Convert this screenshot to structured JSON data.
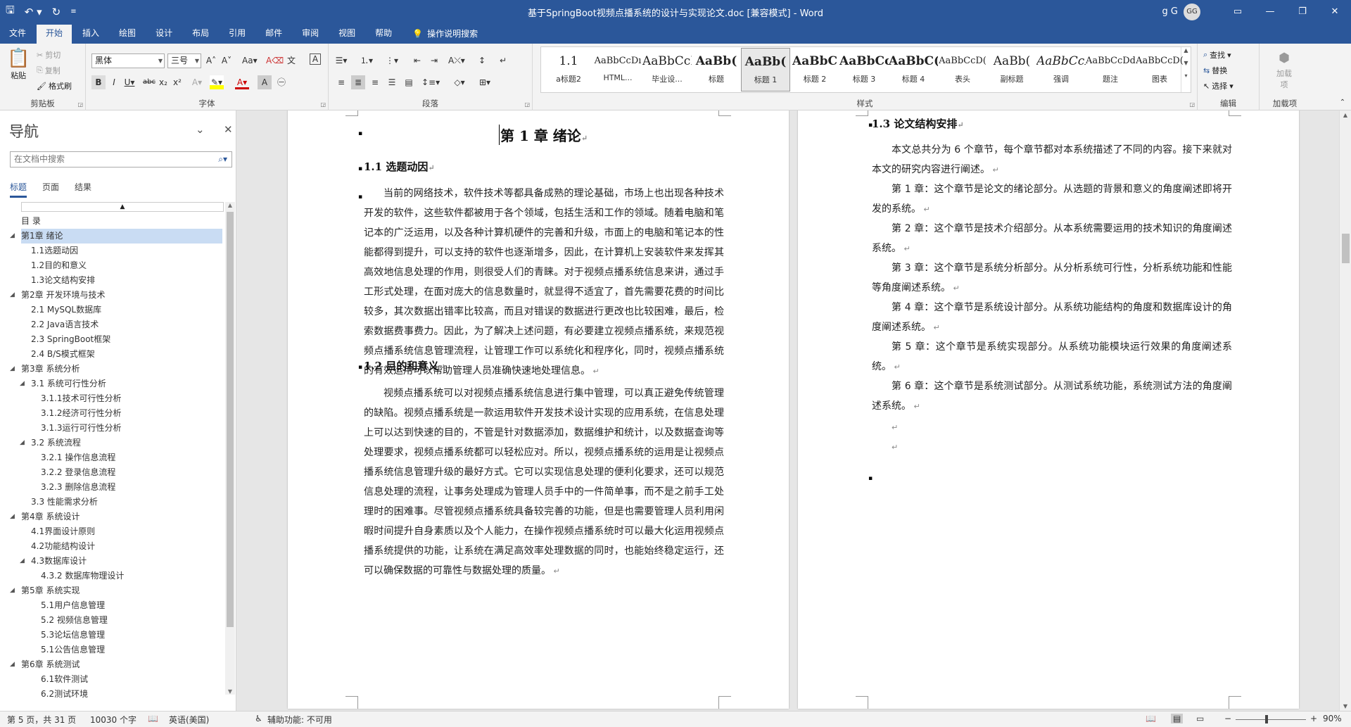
{
  "titlebar": {
    "title": "基于SpringBoot视频点播系统的设计与实现论文.doc [兼容模式] - Word",
    "user": "g G",
    "avatar": "GG",
    "buttons": [
      "ribbon-display-icon",
      "minimize-icon",
      "restore-icon",
      "close-icon"
    ]
  },
  "menu": {
    "tabs": [
      "文件",
      "开始",
      "插入",
      "绘图",
      "设计",
      "布局",
      "引用",
      "邮件",
      "审阅",
      "视图",
      "帮助"
    ],
    "active": "开始",
    "tellme": "操作说明搜索"
  },
  "ribbon": {
    "clipboard": {
      "label": "剪贴板",
      "paste": "粘贴",
      "cut": "剪切",
      "copy": "复制",
      "painter": "格式刷"
    },
    "font": {
      "label": "字体",
      "family": "黑体",
      "size": "三号"
    },
    "paragraph": {
      "label": "段落"
    },
    "styles": {
      "label": "样式",
      "items": [
        {
          "preview": "1.1",
          "name": "a标题2"
        },
        {
          "preview": "AaBbCcDı",
          "name": "HTML..."
        },
        {
          "preview": "AaBbCcI",
          "name": "毕业设..."
        },
        {
          "preview": "AaBb(",
          "name": "标题"
        },
        {
          "preview": "AaBb(",
          "name": "标题 1"
        },
        {
          "preview": "AaBbC",
          "name": "标题 2"
        },
        {
          "preview": "AaBbCc",
          "name": "标题 3"
        },
        {
          "preview": "AaBbC(",
          "name": "标题 4"
        },
        {
          "preview": "AaBbCcD(",
          "name": "表头"
        },
        {
          "preview": "AaBb(",
          "name": "副标题"
        },
        {
          "preview": "AaBbCcL",
          "name": "强调"
        },
        {
          "preview": "AaBbCcDd",
          "name": "题注"
        },
        {
          "preview": "AaBbCcD(",
          "name": "图表"
        }
      ],
      "active_index": 4
    },
    "editing": {
      "label": "编辑",
      "find": "查找",
      "replace": "替换",
      "select": "选择"
    },
    "addins": {
      "label": "加载项",
      "btn": "加载项"
    }
  },
  "nav": {
    "title": "导航",
    "search_placeholder": "在文档中搜索",
    "tabs": [
      "标题",
      "页面",
      "结果"
    ],
    "items": [
      {
        "text": "目  录",
        "level": 0,
        "arrow": ""
      },
      {
        "text": "第1章 绪论",
        "level": 0,
        "arrow": "◢",
        "selected": true
      },
      {
        "text": "1.1选题动因",
        "level": 1,
        "arrow": ""
      },
      {
        "text": "1.2目的和意义",
        "level": 1,
        "arrow": ""
      },
      {
        "text": "1.3论文结构安排",
        "level": 1,
        "arrow": ""
      },
      {
        "text": "第2章 开发环境与技术",
        "level": 0,
        "arrow": "◢"
      },
      {
        "text": "2.1 MySQL数据库",
        "level": 1,
        "arrow": ""
      },
      {
        "text": "2.2 Java语言技术",
        "level": 1,
        "arrow": ""
      },
      {
        "text": "2.3 SpringBoot框架",
        "level": 1,
        "arrow": ""
      },
      {
        "text": "2.4 B/S模式框架",
        "level": 1,
        "arrow": ""
      },
      {
        "text": "第3章 系统分析",
        "level": 0,
        "arrow": "◢"
      },
      {
        "text": "3.1 系统可行性分析",
        "level": 1,
        "arrow": "◢"
      },
      {
        "text": "3.1.1技术可行性分析",
        "level": 2,
        "arrow": ""
      },
      {
        "text": "3.1.2经济可行性分析",
        "level": 2,
        "arrow": ""
      },
      {
        "text": "3.1.3运行可行性分析",
        "level": 2,
        "arrow": ""
      },
      {
        "text": "3.2 系统流程",
        "level": 1,
        "arrow": "◢"
      },
      {
        "text": "3.2.1 操作信息流程",
        "level": 2,
        "arrow": ""
      },
      {
        "text": "3.2.2 登录信息流程",
        "level": 2,
        "arrow": ""
      },
      {
        "text": "3.2.3 删除信息流程",
        "level": 2,
        "arrow": ""
      },
      {
        "text": "3.3 性能需求分析",
        "level": 1,
        "arrow": ""
      },
      {
        "text": "第4章 系统设计",
        "level": 0,
        "arrow": "◢"
      },
      {
        "text": "4.1界面设计原则",
        "level": 1,
        "arrow": ""
      },
      {
        "text": "4.2功能结构设计",
        "level": 1,
        "arrow": ""
      },
      {
        "text": "4.3数据库设计",
        "level": 1,
        "arrow": "◢"
      },
      {
        "text": "4.3.2 数据库物理设计",
        "level": 2,
        "arrow": ""
      },
      {
        "text": "第5章 系统实现",
        "level": 0,
        "arrow": "◢"
      },
      {
        "text": "5.1用户信息管理",
        "level": 2,
        "arrow": ""
      },
      {
        "text": "5.2 视频信息管理",
        "level": 2,
        "arrow": ""
      },
      {
        "text": "5.3论坛信息管理",
        "level": 2,
        "arrow": ""
      },
      {
        "text": "5.1公告信息管理",
        "level": 2,
        "arrow": ""
      },
      {
        "text": "第6章 系统测试",
        "level": 0,
        "arrow": "◢"
      },
      {
        "text": "6.1软件测试",
        "level": 2,
        "arrow": ""
      },
      {
        "text": "6.2测试环境",
        "level": 2,
        "arrow": ""
      }
    ]
  },
  "doc": {
    "page1": {
      "chapter": "第 1 章  绪论",
      "s11": "1.1 选题动因",
      "p1": "当前的网络技术，软件技术等都具备成熟的理论基础，市场上也出现各种技术开发的软件，这些软件都被用于各个领域，包括生活和工作的领域。随着电脑和笔记本的广泛运用，以及各种计算机硬件的完善和升级，市面上的电脑和笔记本的性能都得到提升，可以支持的软件也逐渐增多，因此，在计算机上安装软件来发挥其高效地信息处理的作用，则很受人们的青睐。对于视频点播系统信息来讲，通过手工形式处理，在面对庞大的信息数量时，就显得不适宜了，首先需要花费的时间比较多，其次数据出错率比较高，而且对错误的数据进行更改也比较困难，最后，检索数据费事费力。因此，为了解决上述问题，有必要建立视频点播系统，来规范视频点播系统信息管理流程，让管理工作可以系统化和程序化，同时，视频点播系统的有效运用可以帮助管理人员准确快速地处理信息。",
      "s12": "1.2 目的和意义",
      "p2": "视频点播系统可以对视频点播系统信息进行集中管理，可以真正避免传统管理的缺陷。视频点播系统是一款运用软件开发技术设计实现的应用系统，在信息处理上可以达到快速的目的，不管是针对数据添加，数据维护和统计，以及数据查询等处理要求，视频点播系统都可以轻松应对。所以，视频点播系统的运用是让视频点播系统信息管理升级的最好方式。它可以实现信息处理的便利化要求，还可以规范信息处理的流程，让事务处理成为管理人员手中的一件简单事，而不是之前手工处理时的困难事。尽管视频点播系统具备较完善的功能，但是也需要管理人员利用闲暇时间提升自身素质以及个人能力，在操作视频点播系统时可以最大化运用视频点播系统提供的功能，让系统在满足高效率处理数据的同时，也能始终稳定运行，还可以确保数据的可靠性与数据处理的质量。"
    },
    "page2": {
      "s13": "1.3 论文结构安排",
      "p1": "本文总共分为 6 个章节，每个章节都对本系统描述了不同的内容。接下来就对本文的研究内容进行阐述。",
      "p2": "第 1 章：这个章节是论文的绪论部分。从选题的背景和意义的角度阐述即将开发的系统。",
      "p3": "第 2 章：这个章节是技术介绍部分。从本系统需要运用的技术知识的角度阐述系统。",
      "p4": "第 3 章：这个章节是系统分析部分。从分析系统可行性，分析系统功能和性能等角度阐述系统。",
      "p5": "第 4 章：这个章节是系统设计部分。从系统功能结构的角度和数据库设计的角度阐述系统。",
      "p6": "第 5 章：这个章节是系统实现部分。从系统功能模块运行效果的角度阐述系统。",
      "p7": "第 6 章：这个章节是系统测试部分。从测试系统功能，系统测试方法的角度阐述系统。"
    }
  },
  "status": {
    "page": "第 5 页，共 31 页",
    "words": "10030 个字",
    "lang": "英语(美国)",
    "access": "辅助功能: 不可用",
    "zoom": "90%",
    "zoom_fraction": 0.9
  },
  "colors": {
    "accent": "#2b579a",
    "selected": "#c9dcf3"
  }
}
